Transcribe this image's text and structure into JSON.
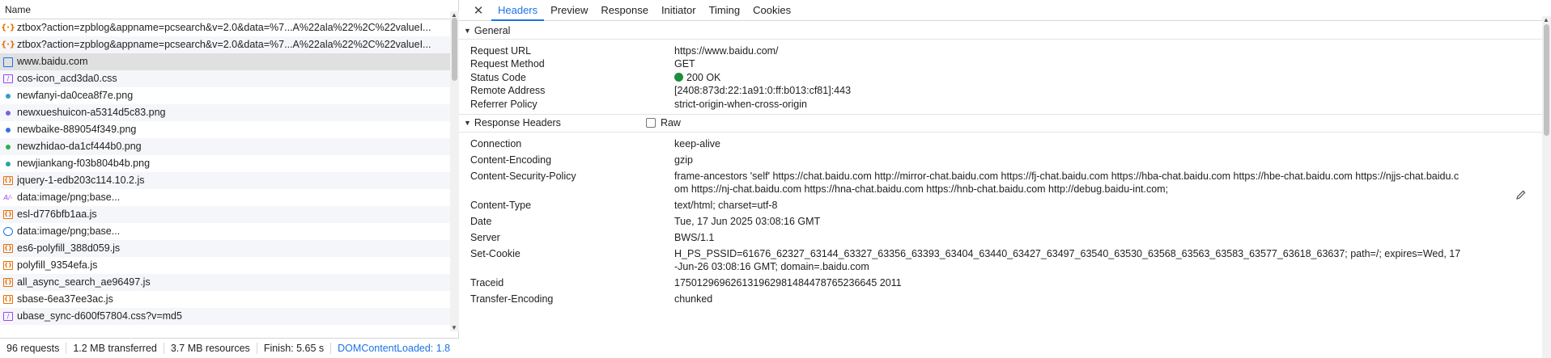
{
  "left": {
    "name_header": "Name",
    "requests": [
      {
        "name": "ztbox?action=zpblog&appname=pcsearch&v=2.0&data=%7...A%22ala%22%2C%22valueI...",
        "icon": "xhr-icon",
        "selected": false
      },
      {
        "name": "ztbox?action=zpblog&appname=pcsearch&v=2.0&data=%7...A%22ala%22%2C%22valueI...",
        "icon": "xhr-icon",
        "selected": false
      },
      {
        "name": "www.baidu.com",
        "icon": "document-icon",
        "selected": true
      },
      {
        "name": "cos-icon_acd3da0.css",
        "icon": "stylesheet-icon",
        "selected": false
      },
      {
        "name": "newfanyi-da0cea8f7e.png",
        "icon": "image-dot-icon",
        "color": "#2aa0c6",
        "selected": false
      },
      {
        "name": "newxueshuicon-a5314d5c83.png",
        "icon": "image-dot-icon",
        "color": "#7b61d9",
        "selected": false
      },
      {
        "name": "newbaike-889054f349.png",
        "icon": "image-dot-icon",
        "color": "#3b6de0",
        "selected": false
      },
      {
        "name": "newzhidao-da1cf444b0.png",
        "icon": "image-dot-icon",
        "color": "#2bb04a",
        "selected": false
      },
      {
        "name": "newjiankang-f03b804b4b.png",
        "icon": "image-dot-icon",
        "color": "#25a7a0",
        "selected": false
      },
      {
        "name": "jquery-1-edb203c114.10.2.js",
        "icon": "script-icon",
        "selected": false
      },
      {
        "name": "data:image/png;base...",
        "icon": "data-image-icon",
        "selected": false
      },
      {
        "name": "esl-d776bfb1aa.js",
        "icon": "script-icon",
        "selected": false
      },
      {
        "name": "data:image/png;base...",
        "icon": "circle-image-icon",
        "selected": false
      },
      {
        "name": "es6-polyfill_388d059.js",
        "icon": "script-icon",
        "selected": false
      },
      {
        "name": "polyfill_9354efa.js",
        "icon": "script-icon",
        "selected": false
      },
      {
        "name": "all_async_search_ae96497.js",
        "icon": "script-icon",
        "selected": false
      },
      {
        "name": "sbase-6ea37ee3ac.js",
        "icon": "script-icon",
        "selected": false
      },
      {
        "name": "ubase_sync-d600f57804.css?v=md5",
        "icon": "stylesheet-icon",
        "selected": false
      }
    ],
    "status": {
      "requests": "96 requests",
      "transferred": "1.2 MB transferred",
      "resources": "3.7 MB resources",
      "finish": "Finish: 5.65 s",
      "domcontentloaded": "DOMContentLoaded: 1.8"
    }
  },
  "tabs": [
    "Headers",
    "Preview",
    "Response",
    "Initiator",
    "Timing",
    "Cookies"
  ],
  "active_tab": "Headers",
  "general": {
    "title": "General",
    "rows": [
      {
        "key": "Request URL",
        "value": "https://www.baidu.com/"
      },
      {
        "key": "Request Method",
        "value": "GET"
      },
      {
        "key": "Status Code",
        "value": "200 OK"
      },
      {
        "key": "Remote Address",
        "value": "[2408:873d:22:1a91:0:ff:b013:cf81]:443"
      },
      {
        "key": "Referrer Policy",
        "value": "strict-origin-when-cross-origin"
      }
    ]
  },
  "response_headers": {
    "title": "Response Headers",
    "raw_label": "Raw",
    "rows": [
      {
        "key": "Connection",
        "value": "keep-alive"
      },
      {
        "key": "Content-Encoding",
        "value": "gzip"
      },
      {
        "key": "Content-Security-Policy",
        "value": "frame-ancestors 'self' https://chat.baidu.com http://mirror-chat.baidu.com https://fj-chat.baidu.com https://hba-chat.baidu.com https://hbe-chat.baidu.com https://njjs-chat.baidu.com https://nj-chat.baidu.com https://hna-chat.baidu.com https://hnb-chat.baidu.com http://debug.baidu-int.com;"
      },
      {
        "key": "Content-Type",
        "value": "text/html; charset=utf-8"
      },
      {
        "key": "Date",
        "value": "Tue, 17 Jun 2025 03:08:16 GMT"
      },
      {
        "key": "Server",
        "value": "BWS/1.1"
      },
      {
        "key": "Set-Cookie",
        "value": "H_PS_PSSID=61676_62327_63144_63327_63356_63393_63404_63440_63427_63497_63540_63530_63568_63563_63583_63577_63618_63637; path=/; expires=Wed, 17-Jun-26 03:08:16 GMT; domain=.baidu.com"
      },
      {
        "key": "Traceid",
        "value": "175012969626131962981484478765236645 2011"
      },
      {
        "key": "Transfer-Encoding",
        "value": "chunked"
      }
    ]
  },
  "colors": {
    "accent": "#1a73e8",
    "status_ok": "#1e8e3e"
  }
}
